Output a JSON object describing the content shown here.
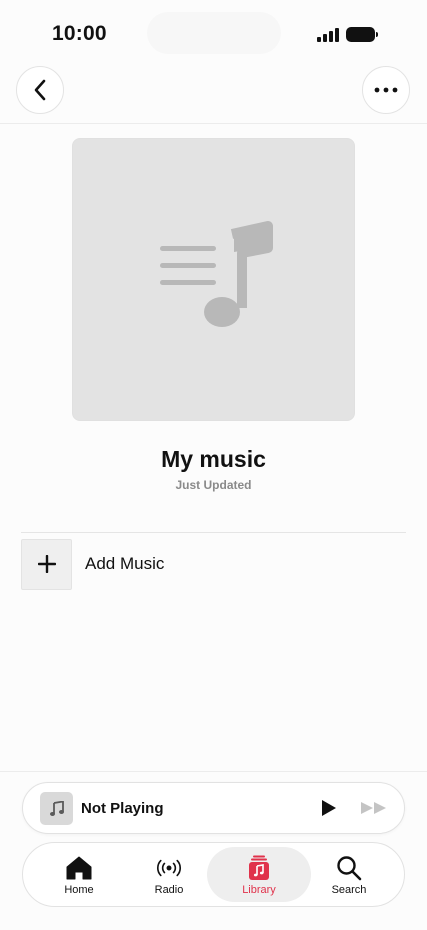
{
  "status_bar": {
    "time": "10:00"
  },
  "nav": {
    "back_icon": "chevron-left-icon",
    "more_icon": "ellipsis-icon"
  },
  "playlist": {
    "title": "My music",
    "subtitle": "Just Updated",
    "artwork_icon": "music-note-list-icon"
  },
  "actions": {
    "add_music_label": "Add Music",
    "add_icon": "plus-icon"
  },
  "mini_player": {
    "title": "Not Playing",
    "art_icon": "music-note-icon",
    "play_icon": "play-icon",
    "forward_icon": "fast-forward-icon"
  },
  "tabs": [
    {
      "label": "Home",
      "icon": "house-icon",
      "active": false
    },
    {
      "label": "Radio",
      "icon": "radio-waves-icon",
      "active": false
    },
    {
      "label": "Library",
      "icon": "library-icon",
      "active": true
    },
    {
      "label": "Search",
      "icon": "magnifier-icon",
      "active": false
    }
  ],
  "colors": {
    "accent": "#e0324b",
    "background": "#fcfcfc",
    "artwork": "#e3e3e3"
  }
}
